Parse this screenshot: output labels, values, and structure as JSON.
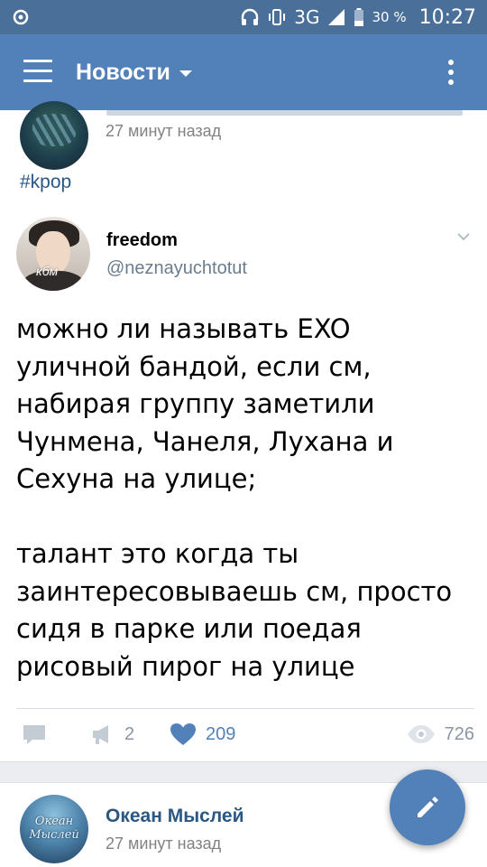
{
  "status_bar": {
    "network": "3G",
    "network_super": "3G",
    "battery": "30 %",
    "time": "10:27"
  },
  "app_bar": {
    "title": "Новости"
  },
  "previous_post": {
    "time": "27 минут назад",
    "hashtag": "#kpop"
  },
  "tweet": {
    "name": "freedom",
    "handle": "@neznayuchtotut",
    "avatar_overlay_text": "кбм",
    "text": "можно ли называть EXO\nуличной бандой, если см,\nнабирая группу заметили\nЧунмена, Чанеля, Лухана и\nСехуна на улице;\n\nталант это когда ты\nзаинтересовываешь см, просто\nсидя в парке или поедая\nрисовый пирог на улице"
  },
  "actions": {
    "comments": "",
    "reposts": "2",
    "likes": "209",
    "views": "726"
  },
  "next_post": {
    "author": "Океан Мыслей",
    "time": "27 минут назад",
    "avatar_text_line1": "Океан",
    "avatar_text_line2": "Мыслей"
  },
  "colors": {
    "status_bar": "#4a6f99",
    "app_bar": "#5181b8",
    "link": "#2a5885",
    "like_active": "#5181b8",
    "muted": "#8b96a1"
  },
  "icons": {
    "menu": "hamburger-menu-icon",
    "more": "vertical-dots-icon",
    "comment": "comment-bubble-icon",
    "share": "megaphone-icon",
    "like": "heart-icon",
    "views": "eye-icon",
    "compose": "pencil-icon"
  }
}
